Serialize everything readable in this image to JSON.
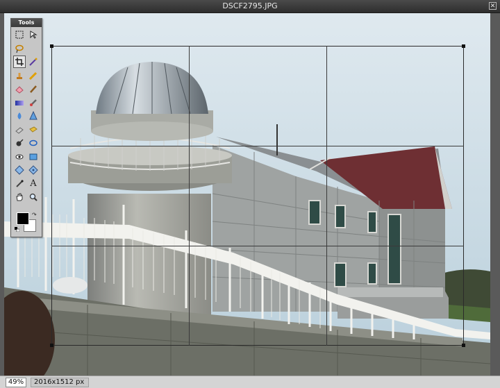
{
  "window": {
    "title": "DSCF2795.JPG",
    "close_icon": "close-icon"
  },
  "tools_panel": {
    "title": "Tools",
    "tools": [
      {
        "name": "rectangle-select-icon",
        "active": false
      },
      {
        "name": "move-icon",
        "active": false
      },
      {
        "name": "lasso-icon",
        "active": false
      },
      {
        "name": "blank",
        "active": false
      },
      {
        "name": "crop-icon",
        "active": true
      },
      {
        "name": "magic-wand-icon",
        "active": false
      },
      {
        "name": "clone-stamp-icon",
        "active": false
      },
      {
        "name": "pencil-icon",
        "active": false
      },
      {
        "name": "eraser-icon",
        "active": false
      },
      {
        "name": "brush-icon",
        "active": false
      },
      {
        "name": "gradient-icon",
        "active": false
      },
      {
        "name": "color-replace-icon",
        "active": false
      },
      {
        "name": "blur-drop-icon",
        "active": false
      },
      {
        "name": "sharpen-icon",
        "active": false
      },
      {
        "name": "smudge-icon",
        "active": false
      },
      {
        "name": "sponge-icon",
        "active": false
      },
      {
        "name": "burn-icon",
        "active": false
      },
      {
        "name": "dodge-icon",
        "active": false
      },
      {
        "name": "red-eye-icon",
        "active": false
      },
      {
        "name": "shape-icon",
        "active": false
      },
      {
        "name": "zoom-target-icon",
        "active": false
      },
      {
        "name": "pan-target-icon",
        "active": false
      },
      {
        "name": "eyedropper-icon",
        "active": false
      },
      {
        "name": "text-icon",
        "active": false
      },
      {
        "name": "hand-icon",
        "active": false
      },
      {
        "name": "zoom-icon",
        "active": false
      }
    ],
    "text_tool_glyph": "A",
    "foreground_color": "#000000",
    "background_color": "#ffffff"
  },
  "status": {
    "zoom": "49%",
    "dimensions": "2016x1512 px"
  }
}
